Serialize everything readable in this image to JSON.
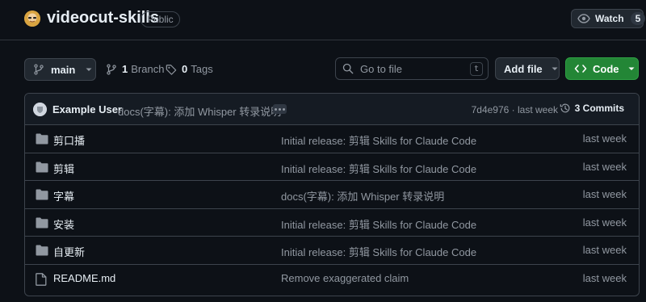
{
  "repo": {
    "name": "videocut-skills",
    "visibility": "Public"
  },
  "watch": {
    "label": "Watch",
    "count": "5"
  },
  "toolbar": {
    "branch": "main",
    "branches_count": "1",
    "branches_label": "Branch",
    "tags_count": "0",
    "tags_label": "Tags",
    "search_placeholder": "Go to file",
    "search_shortcut": "t",
    "add_file_label": "Add file",
    "code_label": "Code"
  },
  "latest_commit": {
    "author": "Example User",
    "message": "docs(字幕): 添加 Whisper 转录说明",
    "meta": "7d4e976 · last week",
    "commits_label": "3 Commits"
  },
  "files": [
    {
      "name": "剪口播",
      "type": "folder",
      "commit": "Initial release: 剪辑 Skills for Claude Code",
      "time": "last week"
    },
    {
      "name": "剪辑",
      "type": "folder",
      "commit": "Initial release: 剪辑 Skills for Claude Code",
      "time": "last week"
    },
    {
      "name": "字幕",
      "type": "folder",
      "commit": "docs(字幕): 添加 Whisper 转录说明",
      "time": "last week"
    },
    {
      "name": "安装",
      "type": "folder",
      "commit": "Initial release: 剪辑 Skills for Claude Code",
      "time": "last week"
    },
    {
      "name": "自更新",
      "type": "folder",
      "commit": "Initial release: 剪辑 Skills for Claude Code",
      "time": "last week"
    },
    {
      "name": "README.md",
      "type": "file",
      "commit": "Remove exaggerated claim",
      "time": "last week"
    }
  ],
  "colors": {
    "background": "#0d1117",
    "border": "#3d444d",
    "code_button": "#238636",
    "muted_text": "#9198a1"
  }
}
